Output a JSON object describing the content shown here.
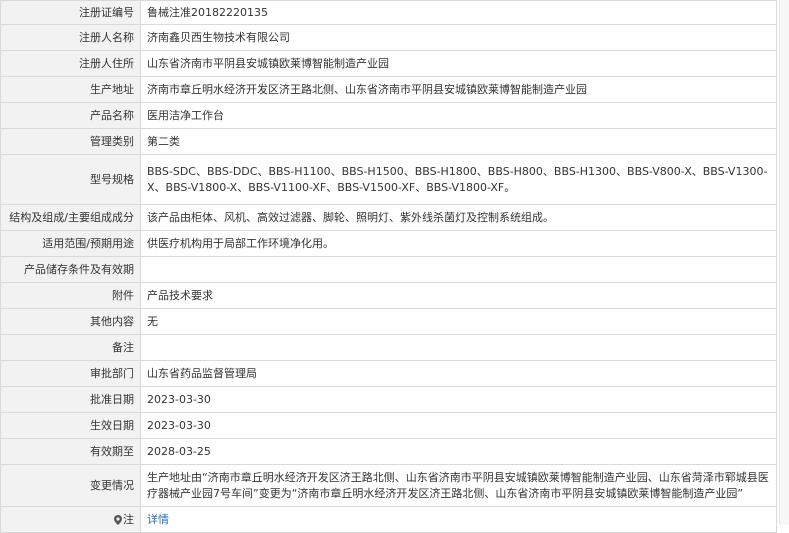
{
  "rows": [
    {
      "label": "注册证编号",
      "value": "鲁械注准20182220135"
    },
    {
      "label": "注册人名称",
      "value": "济南鑫贝西生物技术有限公司"
    },
    {
      "label": "注册人住所",
      "value": "山东省济南市平阴县安城镇欧莱博智能制造产业园"
    },
    {
      "label": "生产地址",
      "value": "济南市章丘明水经济开发区济王路北侧、山东省济南市平阴县安城镇欧莱博智能制造产业园"
    },
    {
      "label": "产品名称",
      "value": "医用洁净工作台"
    },
    {
      "label": "管理类别",
      "value": "第二类"
    },
    {
      "label": "型号规格",
      "value": "BBS-SDC、BBS-DDC、BBS-H1100、BBS-H1500、BBS-H1800、BBS-H800、BBS-H1300、BBS-V800-X、BBS-V1300-X、BBS-V1800-X、BBS-V1100-XF、BBS-V1500-XF、BBS-V1800-XF。"
    },
    {
      "label": "结构及组成/主要组成成分",
      "value": "该产品由柜体、风机、高效过滤器、脚轮、照明灯、紫外线杀菌灯及控制系统组成。"
    },
    {
      "label": "适用范围/预期用途",
      "value": "供医疗机构用于局部工作环境净化用。"
    },
    {
      "label": "产品储存条件及有效期",
      "value": ""
    },
    {
      "label": "附件",
      "value": "产品技术要求"
    },
    {
      "label": "其他内容",
      "value": "无"
    },
    {
      "label": "备注",
      "value": ""
    },
    {
      "label": "审批部门",
      "value": "山东省药品监督管理局"
    },
    {
      "label": "批准日期",
      "value": "2023-03-30"
    },
    {
      "label": "生效日期",
      "value": "2023-03-30"
    },
    {
      "label": "有效期至",
      "value": "2028-03-25"
    },
    {
      "label": "变更情况",
      "value": "生产地址由“济南市章丘明水经济开发区济王路北侧、山东省济南市平阴县安城镇欧莱博智能制造产业园、山东省菏泽市郓城县医疗器械产业园7号车间”变更为“济南市章丘明水经济开发区济王路北侧、山东省济南市平阴县安城镇欧莱博智能制造产业园”"
    },
    {
      "label": "注",
      "value": "详情"
    }
  ],
  "colors": {
    "label_bg": "#f2f2f2",
    "border": "#d9d9d9",
    "link": "#2d6db5"
  },
  "icons": {
    "note_row": "location-pin-icon"
  }
}
